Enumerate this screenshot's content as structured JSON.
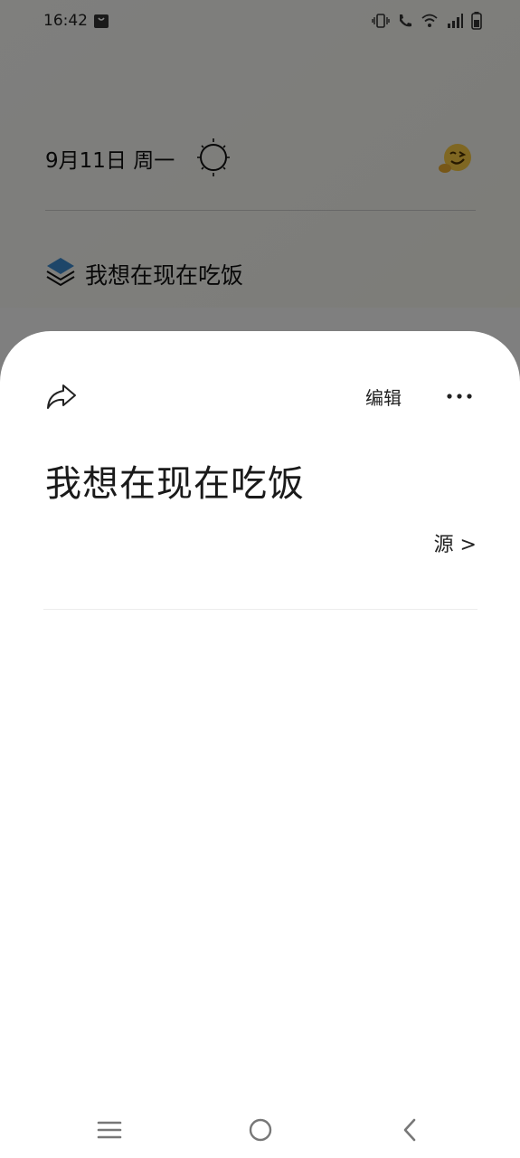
{
  "status_bar": {
    "time": "16:42"
  },
  "background": {
    "date": "9月11日 周一",
    "entry_text": "我想在现在吃饭"
  },
  "sheet": {
    "edit_label": "编辑",
    "title": "我想在现在吃饭",
    "source_label": "源 >"
  },
  "icons": {
    "share": "share-icon",
    "more": "more-icon",
    "weather": "sun-icon",
    "mood": "emoji-icon",
    "entry": "layers-icon"
  }
}
